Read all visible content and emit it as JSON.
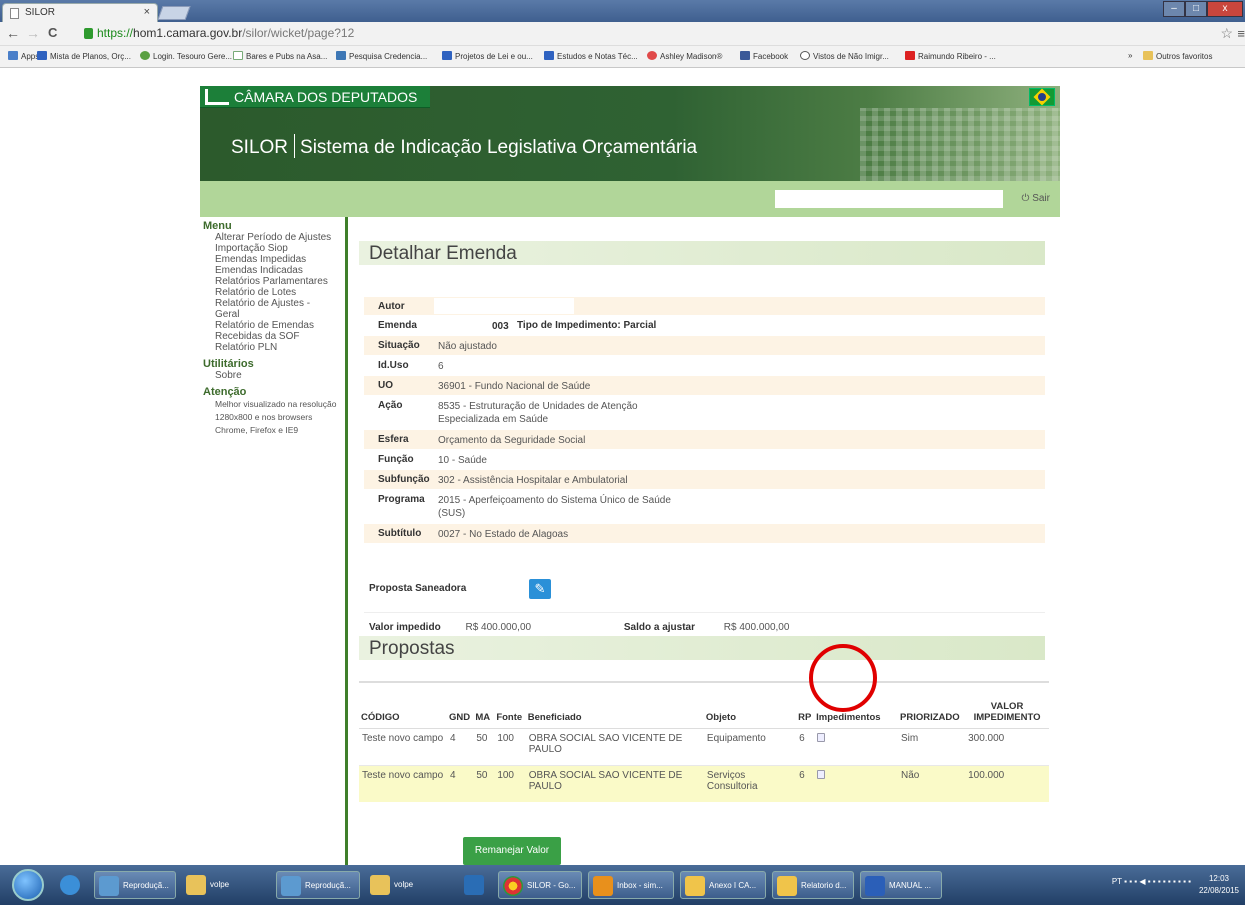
{
  "browser": {
    "tab_title": "SILOR",
    "tab_close": "×",
    "url_protocol": "https://",
    "url_host": "hom1.camara.gov.br",
    "url_path": "/silor/wicket/page?12",
    "nav_back": "←",
    "nav_forward": "→",
    "nav_reload": "C",
    "star": "☆",
    "menu": "≡",
    "window_min": "–",
    "window_max": "□",
    "window_close": "x"
  },
  "bookmarks": [
    "Apps",
    "Mista de Planos, Orç...",
    "Login. Tesouro Gere...",
    "Bares e Pubs na Asa...",
    "Pesquisa Credencia...",
    "Projetos de Lei e ou...",
    "Estudos e Notas Téc...",
    "Ashley Madison®",
    "Facebook",
    "Vistos de Não Imigr...",
    "Raimundo Ribeiro - ...",
    "»",
    "Outros favoritos"
  ],
  "header": {
    "org": "CÂMARA DOS DEPUTADOS",
    "app_short": "SILOR",
    "app_full": "Sistema de Indicação Legislativa Orçamentária",
    "logout": "Sair"
  },
  "sidebar": {
    "menu_title": "Menu",
    "menu_items": [
      "Alterar Período de Ajustes",
      "Importação Siop",
      "Emendas Impedidas",
      "Emendas Indicadas",
      "Relatórios Parlamentares",
      "Relatório de Lotes",
      "Relatório de Ajustes - Geral",
      "Relatório de Emendas Recebidas da SOF",
      "Relatório PLN"
    ],
    "util_title": "Utilitários",
    "util_items": [
      "Sobre"
    ],
    "attention_title": "Atenção",
    "attention_text": "Melhor visualizado na resolução 1280x800 e nos browsers Chrome, Firefox e IE9"
  },
  "detail": {
    "title": "Detalhar Emenda",
    "rows": [
      {
        "label": "Autor",
        "value": ""
      },
      {
        "label": "Emenda",
        "value": "003",
        "extra": "Tipo de Impedimento: Parcial"
      },
      {
        "label": "Situação",
        "value": "Não ajustado"
      },
      {
        "label": "Id.Uso",
        "value": "6"
      },
      {
        "label": "UO",
        "value": "36901 - Fundo Nacional de Saúde"
      },
      {
        "label": "Ação",
        "value": "8535 - Estruturação de Unidades de Atenção Especializada em Saúde"
      },
      {
        "label": "Esfera",
        "value": "Orçamento da Seguridade Social"
      },
      {
        "label": "Função",
        "value": "10 - Saúde"
      },
      {
        "label": "Subfunção",
        "value": "302 - Assistência Hospitalar e Ambulatorial"
      },
      {
        "label": "Programa",
        "value": "2015 - Aperfeiçoamento do Sistema Único de Saúde (SUS)"
      },
      {
        "label": "Subtítulo",
        "value": "0027 - No Estado de Alagoas"
      }
    ],
    "proposta_label": "Proposta Saneadora",
    "valor_impedido_label": "Valor impedido",
    "valor_impedido": "R$ 400.000,00",
    "saldo_label": "Saldo a ajustar",
    "saldo": "R$ 400.000,00"
  },
  "propostas": {
    "title": "Propostas",
    "columns": [
      "CÓDIGO",
      "GND",
      "MA",
      "Fonte",
      "Beneficiado",
      "Objeto",
      "RP",
      "Impedimentos",
      "PRIORIZADO",
      "VALOR IMPEDIMENTO"
    ],
    "rows": [
      {
        "codigo": "Teste novo campo",
        "gnd": "4",
        "ma": "50",
        "fonte": "100",
        "beneficiado": "OBRA SOCIAL SAO VICENTE DE PAULO",
        "objeto": "Equipamento",
        "rp": "6",
        "priorizado": "Sim",
        "valor": "300.000"
      },
      {
        "codigo": "Teste novo campo",
        "gnd": "4",
        "ma": "50",
        "fonte": "100",
        "beneficiado": "OBRA SOCIAL SAO VICENTE DE PAULO",
        "objeto": "Serviços Consultoria",
        "rp": "6",
        "priorizado": "Não",
        "valor": "100.000"
      }
    ],
    "button": "Remanejar Valor"
  },
  "taskbar": {
    "items": [
      "Reproduçã...",
      "volpe",
      "Reproduçã...",
      "volpe",
      "",
      "SILOR - Go...",
      "Inbox - sim...",
      "Anexo I CA...",
      "Relatorio d...",
      "MANUAL ..."
    ],
    "lang": "PT",
    "time": "12:03",
    "date": "22/08/2015"
  }
}
